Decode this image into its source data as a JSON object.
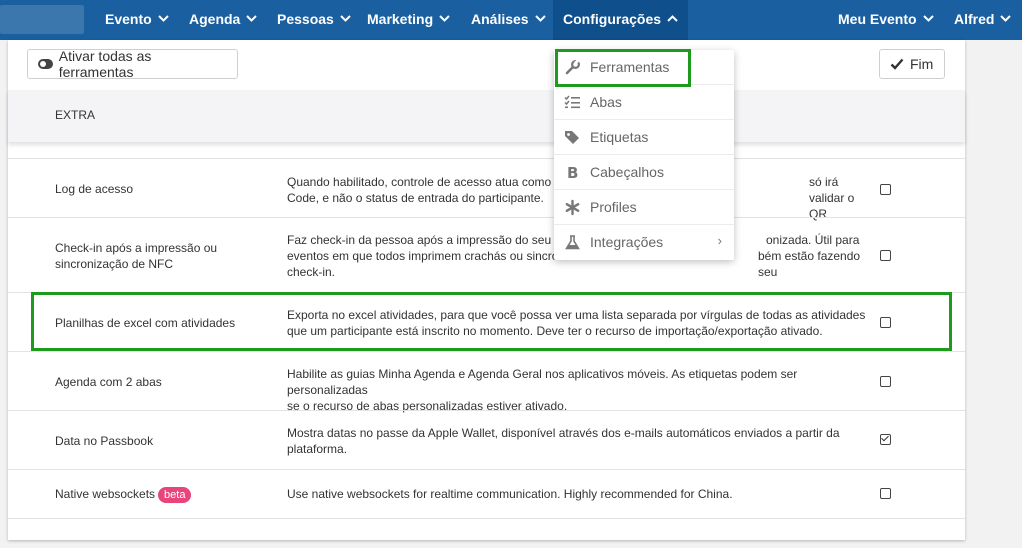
{
  "nav": {
    "items": [
      {
        "label": "Evento"
      },
      {
        "label": "Agenda"
      },
      {
        "label": "Pessoas"
      },
      {
        "label": "Marketing"
      },
      {
        "label": "Análises"
      },
      {
        "label": "Configurações"
      }
    ],
    "right_items": [
      {
        "label": "Meu Evento"
      },
      {
        "label": "Alfred"
      }
    ],
    "active": "Configurações"
  },
  "toolbar": {
    "enable_all_label": "Ativar todas as ferramentas",
    "done_label": "Fim"
  },
  "section": {
    "title": "EXTRA"
  },
  "rows": [
    {
      "name": "Log de acesso",
      "description": "Quando habilitado, controle de acesso atua como l… só irá validar o QR Code, e não o status de entrada do participante.",
      "desc_line1": "Quando habilitado, controle de acesso atua como l",
      "desc_line1_tail": "só irá validar o QR",
      "desc_line2": "Code, e não o status de entrada do participante.",
      "checked": false
    },
    {
      "name_line1": "Check-in após a impressão ou",
      "name_line2": "sincronização de NFC",
      "desc_line1": "Faz check-in da pessoa após a impressão do seu cra",
      "desc_line1_tail": "onizada. Útil para",
      "desc_line2": "eventos em que todos imprimem crachás ou sincron",
      "desc_line2_tail": "bém estão fazendo seu",
      "desc_line3": "check-in.",
      "checked": false
    },
    {
      "name": "Planilhas de excel com atividades",
      "desc_line1": "Exporta no excel atividades, para que você possa ver uma lista separada por vírgulas de todas as atividades",
      "desc_line2": "que um participante está inscrito no momento. Deve ter o recurso de importação/exportação ativado.",
      "checked": false
    },
    {
      "name": "Agenda com 2 abas",
      "desc_line1": "Habilite as guias Minha Agenda e Agenda Geral nos aplicativos móveis. As etiquetas podem ser personalizadas",
      "desc_line2": "se o recurso de abas personalizadas estiver ativado.",
      "checked": false
    },
    {
      "name": "Data no Passbook",
      "desc_line1": "Mostra datas no passe da Apple Wallet, disponível através dos e-mails automáticos enviados a partir da",
      "desc_line2": "plataforma.",
      "checked": true
    },
    {
      "name": "Native websockets",
      "badge": "beta",
      "desc_line1": "Use native websockets for realtime communication. Highly recommended for China.",
      "checked": false
    }
  ],
  "dropdown": {
    "items": [
      {
        "label": "Ferramentas",
        "icon": "wrench-icon"
      },
      {
        "label": "Abas",
        "icon": "list-check-icon"
      },
      {
        "label": "Etiquetas",
        "icon": "tags-icon"
      },
      {
        "label": "Cabeçalhos",
        "icon": "bold-b-icon"
      },
      {
        "label": "Profiles",
        "icon": "asterisk-icon"
      },
      {
        "label": "Integrações",
        "icon": "flask-icon",
        "submenu": true
      }
    ]
  },
  "colors": {
    "nav_bg": "#1a5fa0",
    "nav_active": "#0f4f8c",
    "highlight": "#1e9a1e",
    "badge": "#e8457a"
  }
}
